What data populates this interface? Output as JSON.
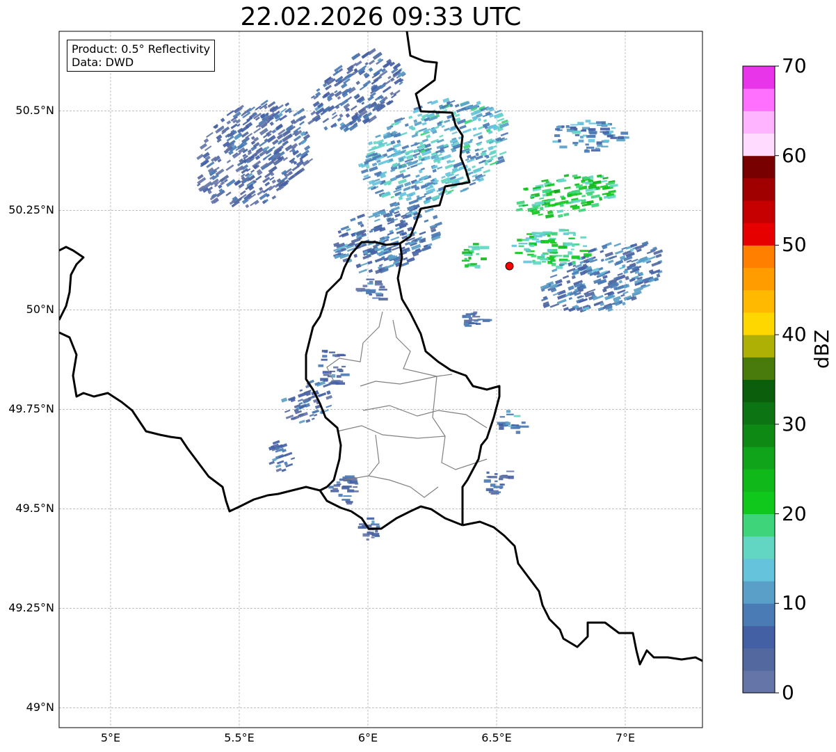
{
  "title": "22.02.2026 09:33 UTC",
  "info": {
    "product": "Product: 0.5° Reflectivity",
    "data": "Data: DWD"
  },
  "map": {
    "lon_range": [
      4.8,
      7.3
    ],
    "lat_range": [
      48.95,
      50.7
    ],
    "lat_ticks": [
      {
        "value": 49.0,
        "label": "49°N"
      },
      {
        "value": 49.25,
        "label": "49.25°N"
      },
      {
        "value": 49.5,
        "label": "49.5°N"
      },
      {
        "value": 49.75,
        "label": "49.75°N"
      },
      {
        "value": 50.0,
        "label": "50°N"
      },
      {
        "value": 50.25,
        "label": "50.25°N"
      },
      {
        "value": 50.5,
        "label": "50.5°N"
      }
    ],
    "lon_ticks": [
      {
        "value": 5.0,
        "label": "5°E"
      },
      {
        "value": 5.5,
        "label": "5.5°E"
      },
      {
        "value": 6.0,
        "label": "6°E"
      },
      {
        "value": 6.5,
        "label": "6.5°E"
      },
      {
        "value": 7.0,
        "label": "7°E"
      }
    ],
    "gridlines": true,
    "radar_site": {
      "lon": 6.55,
      "lat": 50.11,
      "color": "#ff0000"
    }
  },
  "colorbar": {
    "label": "dBZ",
    "min": 0,
    "max": 70,
    "ticks": [
      {
        "value": 0,
        "label": "0"
      },
      {
        "value": 10,
        "label": "10"
      },
      {
        "value": 20,
        "label": "20"
      },
      {
        "value": 30,
        "label": "30"
      },
      {
        "value": 40,
        "label": "40"
      },
      {
        "value": 50,
        "label": "50"
      },
      {
        "value": 60,
        "label": "60"
      },
      {
        "value": 70,
        "label": "70"
      }
    ],
    "colors": [
      "#6575a8",
      "#5468a0",
      "#4460a4",
      "#4b7bb4",
      "#5a9fc8",
      "#66c3dc",
      "#63d6c3",
      "#3dd47a",
      "#10c81c",
      "#10b81a",
      "#10a41a",
      "#0e8a14",
      "#0c7412",
      "#0a5e0c",
      "#487a0c",
      "#aeb006",
      "#ffd700",
      "#ffb900",
      "#ff9d00",
      "#ff7f00",
      "#e60000",
      "#c60000",
      "#a00000",
      "#780000",
      "#ffdcff",
      "#ffb4ff",
      "#ff70ff",
      "#e935e9"
    ]
  },
  "echo_clusters": [
    {
      "lon": 5.55,
      "lat": 50.39,
      "rx": 0.25,
      "ry": 0.12,
      "angle": -35,
      "level": 8
    },
    {
      "lon": 5.95,
      "lat": 50.55,
      "rx": 0.2,
      "ry": 0.08,
      "angle": -35,
      "level": 8
    },
    {
      "lon": 6.25,
      "lat": 50.4,
      "rx": 0.3,
      "ry": 0.12,
      "angle": -20,
      "level": 14
    },
    {
      "lon": 6.05,
      "lat": 50.18,
      "rx": 0.22,
      "ry": 0.08,
      "angle": -20,
      "level": 10
    },
    {
      "lon": 6.85,
      "lat": 50.44,
      "rx": 0.15,
      "ry": 0.04,
      "angle": 0,
      "level": 12
    },
    {
      "lon": 6.75,
      "lat": 50.29,
      "rx": 0.2,
      "ry": 0.05,
      "angle": -10,
      "level": 22
    },
    {
      "lon": 6.9,
      "lat": 50.08,
      "rx": 0.25,
      "ry": 0.08,
      "angle": -20,
      "level": 10
    },
    {
      "lon": 6.7,
      "lat": 50.16,
      "rx": 0.15,
      "ry": 0.05,
      "angle": 0,
      "level": 20
    },
    {
      "lon": 6.4,
      "lat": 50.14,
      "rx": 0.05,
      "ry": 0.03,
      "angle": 0,
      "level": 22
    },
    {
      "lon": 6.55,
      "lat": 49.72,
      "rx": 0.05,
      "ry": 0.03,
      "angle": 0,
      "level": 12
    },
    {
      "lon": 5.75,
      "lat": 49.77,
      "rx": 0.1,
      "ry": 0.05,
      "angle": -20,
      "level": 8
    },
    {
      "lon": 5.85,
      "lat": 49.86,
      "rx": 0.05,
      "ry": 0.05,
      "angle": 0,
      "level": 8
    },
    {
      "lon": 5.9,
      "lat": 49.55,
      "rx": 0.06,
      "ry": 0.04,
      "angle": 0,
      "level": 8
    },
    {
      "lon": 6.0,
      "lat": 49.45,
      "rx": 0.04,
      "ry": 0.03,
      "angle": 0,
      "level": 8
    },
    {
      "lon": 6.5,
      "lat": 49.57,
      "rx": 0.05,
      "ry": 0.04,
      "angle": 0,
      "level": 8
    },
    {
      "lon": 5.65,
      "lat": 49.63,
      "rx": 0.05,
      "ry": 0.04,
      "angle": -20,
      "level": 8
    },
    {
      "lon": 6.0,
      "lat": 50.05,
      "rx": 0.06,
      "ry": 0.03,
      "angle": 0,
      "level": 8
    },
    {
      "lon": 6.4,
      "lat": 49.98,
      "rx": 0.05,
      "ry": 0.02,
      "angle": 0,
      "level": 8
    }
  ]
}
